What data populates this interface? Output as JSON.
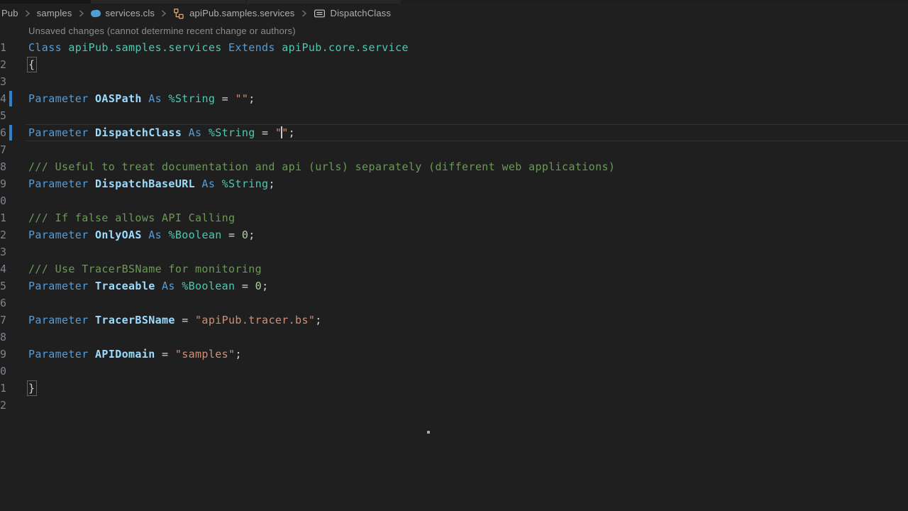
{
  "breadcrumb": {
    "items": [
      {
        "label": "Pub"
      },
      {
        "label": "samples"
      },
      {
        "label": "services.cls",
        "icon": "file-objectscript-icon"
      },
      {
        "label": "apiPub.samples.services",
        "icon": "symbol-class-icon"
      },
      {
        "label": "DispatchClass",
        "icon": "symbol-parameter-icon"
      }
    ]
  },
  "annotation": {
    "text": "Unsaved changes (cannot determine recent change or authors)"
  },
  "editor": {
    "lines": [
      {
        "num": "1",
        "tokens": [
          {
            "t": "kw",
            "s": "Class "
          },
          {
            "t": "ty",
            "s": "apiPub.samples.services"
          },
          {
            "t": "pu",
            "s": " "
          },
          {
            "t": "kw",
            "s": "Extends "
          },
          {
            "t": "ty",
            "s": "apiPub.core.service"
          }
        ]
      },
      {
        "num": "2",
        "tokens": [
          {
            "t": "br",
            "s": "{",
            "match": true
          }
        ]
      },
      {
        "num": "3",
        "tokens": []
      },
      {
        "num": "4",
        "modified": true,
        "tokens": [
          {
            "t": "kw",
            "s": "Parameter "
          },
          {
            "t": "id",
            "s": "OASPath"
          },
          {
            "t": "kw",
            "s": " As "
          },
          {
            "t": "ty",
            "s": "%String"
          },
          {
            "t": "pu",
            "s": " = "
          },
          {
            "t": "st",
            "s": "\"\""
          },
          {
            "t": "pu",
            "s": ";"
          }
        ]
      },
      {
        "num": "5",
        "tokens": []
      },
      {
        "num": "6",
        "modified": true,
        "current": true,
        "tokens": [
          {
            "t": "kw",
            "s": "Parameter "
          },
          {
            "t": "id",
            "s": "DispatchClass"
          },
          {
            "t": "kw",
            "s": " As "
          },
          {
            "t": "ty",
            "s": "%String"
          },
          {
            "t": "pu",
            "s": " = "
          },
          {
            "t": "st",
            "s": "\""
          },
          {
            "t": "cursor",
            "s": ""
          },
          {
            "t": "st",
            "s": "\""
          },
          {
            "t": "pu",
            "s": ";"
          }
        ]
      },
      {
        "num": "7",
        "tokens": []
      },
      {
        "num": "8",
        "tokens": [
          {
            "t": "co",
            "s": "/// Useful to treat documentation and api (urls) separately (different web applications)"
          }
        ]
      },
      {
        "num": "9",
        "tokens": [
          {
            "t": "kw",
            "s": "Parameter "
          },
          {
            "t": "id",
            "s": "DispatchBaseURL"
          },
          {
            "t": "kw",
            "s": " As "
          },
          {
            "t": "ty",
            "s": "%String"
          },
          {
            "t": "pu",
            "s": ";"
          }
        ]
      },
      {
        "num": "0",
        "tokens": []
      },
      {
        "num": "1",
        "tokens": [
          {
            "t": "co",
            "s": "/// If false allows API Calling"
          }
        ]
      },
      {
        "num": "2",
        "tokens": [
          {
            "t": "kw",
            "s": "Parameter "
          },
          {
            "t": "id",
            "s": "OnlyOAS"
          },
          {
            "t": "kw",
            "s": " As "
          },
          {
            "t": "ty",
            "s": "%Boolean"
          },
          {
            "t": "pu",
            "s": " = "
          },
          {
            "t": "nu",
            "s": "0"
          },
          {
            "t": "pu",
            "s": ";"
          }
        ]
      },
      {
        "num": "3",
        "tokens": []
      },
      {
        "num": "4",
        "tokens": [
          {
            "t": "co",
            "s": "/// Use TracerBSName for monitoring"
          }
        ]
      },
      {
        "num": "5",
        "tokens": [
          {
            "t": "kw",
            "s": "Parameter "
          },
          {
            "t": "id",
            "s": "Traceable"
          },
          {
            "t": "kw",
            "s": " As "
          },
          {
            "t": "ty",
            "s": "%Boolean"
          },
          {
            "t": "pu",
            "s": " = "
          },
          {
            "t": "nu",
            "s": "0"
          },
          {
            "t": "pu",
            "s": ";"
          }
        ]
      },
      {
        "num": "6",
        "tokens": []
      },
      {
        "num": "7",
        "tokens": [
          {
            "t": "kw",
            "s": "Parameter "
          },
          {
            "t": "id",
            "s": "TracerBSName"
          },
          {
            "t": "pu",
            "s": " = "
          },
          {
            "t": "st",
            "s": "\"apiPub.tracer.bs\""
          },
          {
            "t": "pu",
            "s": ";"
          }
        ]
      },
      {
        "num": "8",
        "tokens": []
      },
      {
        "num": "9",
        "tokens": [
          {
            "t": "kw",
            "s": "Parameter "
          },
          {
            "t": "id",
            "s": "APIDomain"
          },
          {
            "t": "pu",
            "s": " = "
          },
          {
            "t": "st",
            "s": "\"samples\""
          },
          {
            "t": "pu",
            "s": ";"
          }
        ]
      },
      {
        "num": "0",
        "tokens": []
      },
      {
        "num": "1",
        "tokens": [
          {
            "t": "br",
            "s": "}",
            "match": true
          }
        ]
      },
      {
        "num": "2",
        "tokens": []
      }
    ]
  },
  "colors": {
    "background": "#1f1f1f",
    "keyword": "#569cd6",
    "identifier": "#9cdcfe",
    "class_type": "#4ec9b0",
    "string": "#ce9178",
    "number": "#b5cea8",
    "comment": "#6a9955",
    "line_number": "#7d8590",
    "modified_bar": "#2f81c9",
    "breadcrumb_text": "#b0b0b0",
    "file_icon_blue": "#4f9fd6",
    "class_icon_orange": "#d7a873"
  }
}
